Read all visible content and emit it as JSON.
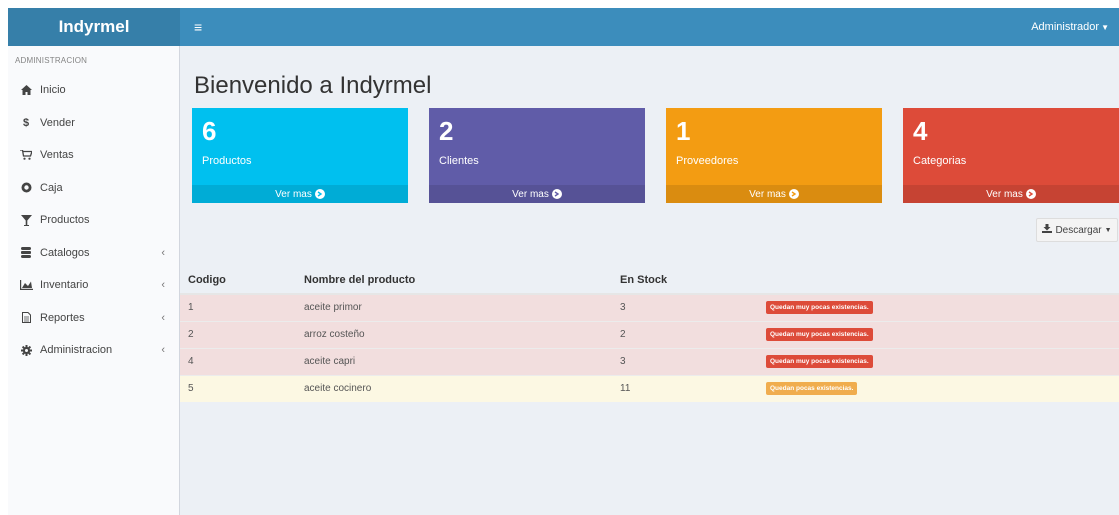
{
  "header": {
    "logo": "Indyrmel",
    "menu_toggle": "≡",
    "user": "Administrador"
  },
  "sidebar": {
    "section": "ADMINISTRACION",
    "items": [
      {
        "label": "Inicio",
        "icon": "home-icon",
        "submenu": false
      },
      {
        "label": "Vender",
        "icon": "dollar-icon",
        "submenu": false
      },
      {
        "label": "Ventas",
        "icon": "cart-icon",
        "submenu": false
      },
      {
        "label": "Caja",
        "icon": "coins-icon",
        "submenu": false
      },
      {
        "label": "Productos",
        "icon": "glass-icon",
        "submenu": false
      },
      {
        "label": "Catalogos",
        "icon": "database-icon",
        "submenu": true
      },
      {
        "label": "Inventario",
        "icon": "chart-icon",
        "submenu": true
      },
      {
        "label": "Reportes",
        "icon": "file-icon",
        "submenu": true
      },
      {
        "label": "Administracion",
        "icon": "cog-icon",
        "submenu": true
      }
    ]
  },
  "main": {
    "title": "Bienvenido a Indyrmel",
    "boxes": [
      {
        "count": "6",
        "label": "Productos",
        "link": "Ver mas",
        "color": "#00c0ef"
      },
      {
        "count": "2",
        "label": "Clientes",
        "link": "Ver mas",
        "color": "#605ca8"
      },
      {
        "count": "1",
        "label": "Proveedores",
        "link": "Ver mas",
        "color": "#f39c12"
      },
      {
        "count": "4",
        "label": "Categorias",
        "link": "Ver mas",
        "color": "#dd4b39"
      }
    ],
    "download_label": "Descargar",
    "table": {
      "headers": [
        "Codigo",
        "Nombre del producto",
        "En Stock",
        ""
      ],
      "rows": [
        {
          "code": "1",
          "name": "aceite primor",
          "stock": "3",
          "status": "Quedan muy pocas existencias.",
          "level": "danger"
        },
        {
          "code": "2",
          "name": "arroz costeño",
          "stock": "2",
          "status": "Quedan muy pocas existencias.",
          "level": "danger"
        },
        {
          "code": "4",
          "name": "aceite capri",
          "stock": "3",
          "status": "Quedan muy pocas existencias.",
          "level": "danger"
        },
        {
          "code": "5",
          "name": "aceite cocinero",
          "stock": "11",
          "status": "Quedan pocas existencias.",
          "level": "warning"
        }
      ]
    }
  }
}
